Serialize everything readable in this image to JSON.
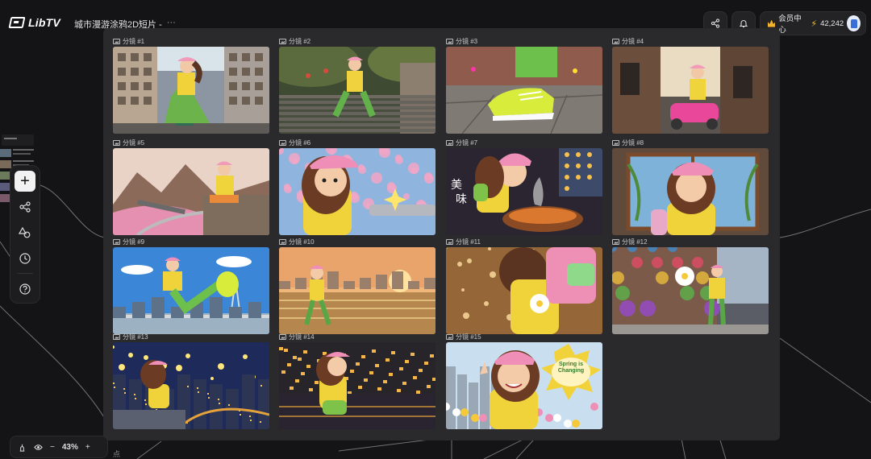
{
  "app": {
    "logo_text": "LibTV"
  },
  "project": {
    "title": "城市漫游涂鸦2D短片 -",
    "more": "···"
  },
  "header": {
    "member_label": "会员中心",
    "credits": "42,242",
    "icons": [
      "share-icon",
      "bell-icon",
      "crown-icon",
      "bolt-icon"
    ]
  },
  "board": {
    "shots": [
      {
        "label": "分镜 #1",
        "scene": "street"
      },
      {
        "label": "分镜 #2",
        "scene": "stairs"
      },
      {
        "label": "分镜 #3",
        "scene": "shoe"
      },
      {
        "label": "分镜 #4",
        "scene": "alley"
      },
      {
        "label": "分镜 #5",
        "scene": "mountain"
      },
      {
        "label": "分镜 #6",
        "scene": "blossom"
      },
      {
        "label": "分镜 #7",
        "scene": "food",
        "text": "美味"
      },
      {
        "label": "分镜 #8",
        "scene": "window"
      },
      {
        "label": "分镜 #9",
        "scene": "sky"
      },
      {
        "label": "分镜 #10",
        "scene": "sunset"
      },
      {
        "label": "分镜 #11",
        "scene": "bag"
      },
      {
        "label": "分镜 #12",
        "scene": "graffiti"
      },
      {
        "label": "分镜 #13",
        "scene": "night"
      },
      {
        "label": "分镜 #14",
        "scene": "nightcity"
      },
      {
        "label": "分镜 #15",
        "scene": "spring",
        "text": "Spring is Changing"
      }
    ]
  },
  "toolbar": {
    "icons": [
      "add-icon",
      "workflow-icon",
      "shapes-icon",
      "history-icon",
      "help-icon"
    ]
  },
  "zoom": {
    "value": "43%"
  },
  "bottom_fragment": "点"
}
